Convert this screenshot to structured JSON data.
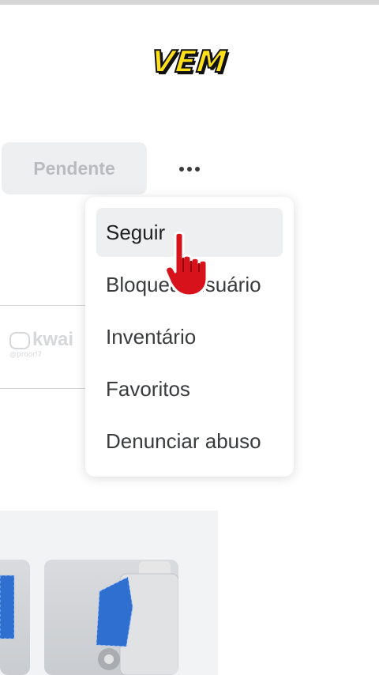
{
  "video_caption": "VEM",
  "profile": {
    "pending_button_label": "Pendente",
    "more_icon": "ellipsis-icon"
  },
  "watermark": {
    "brand": "kwai",
    "handle": "@proorl7"
  },
  "dropdown_menu": {
    "items": [
      {
        "label": "Seguir",
        "highlighted": true
      },
      {
        "label": "Bloquear usuário",
        "highlighted": false
      },
      {
        "label": "Inventário",
        "highlighted": false
      },
      {
        "label": "Favoritos",
        "highlighted": false
      },
      {
        "label": "Denunciar abuso",
        "highlighted": false
      }
    ]
  },
  "cursor_icon": "hand-pointer-icon",
  "colors": {
    "caption_fill": "#ffe11a",
    "cursor_red": "#d8121a",
    "menu_highlight": "#eeeff1",
    "button_bg": "#eeeff1"
  }
}
